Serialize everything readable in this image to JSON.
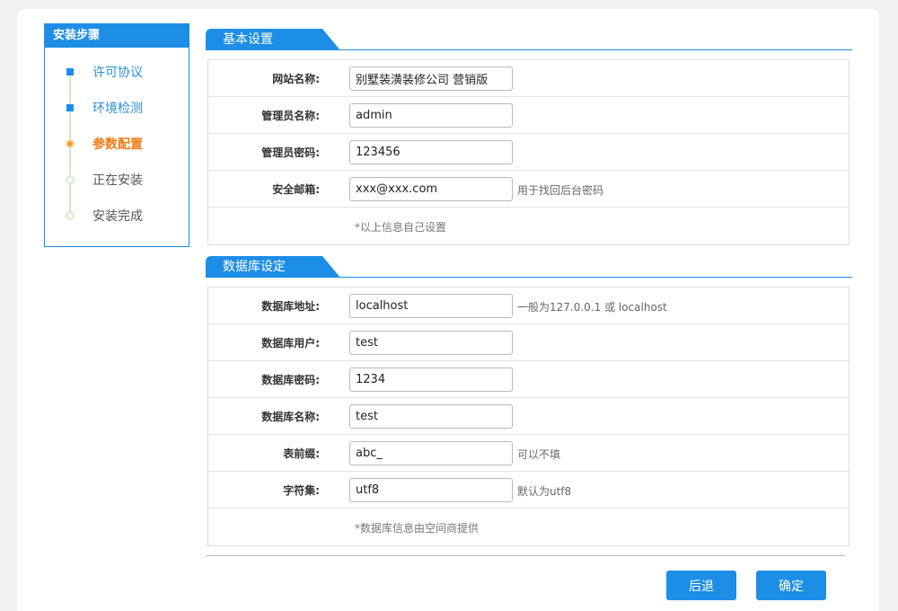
{
  "sidebar": {
    "title": "安装步骤",
    "steps": [
      {
        "label": "许可协议",
        "state": "done"
      },
      {
        "label": "环境检测",
        "state": "done"
      },
      {
        "label": "参数配置",
        "state": "current"
      },
      {
        "label": "正在安装",
        "state": "todo"
      },
      {
        "label": "安装完成",
        "state": "todo"
      }
    ]
  },
  "basic": {
    "title": "基本设置",
    "site_name_label": "网站名称:",
    "site_name_value": "别墅装潢装修公司 营销版",
    "admin_name_label": "管理员名称:",
    "admin_name_value": "admin",
    "admin_pwd_label": "管理员密码:",
    "admin_pwd_value": "123456",
    "email_label": "安全邮箱:",
    "email_value": "xxx@xxx.com",
    "email_hint": "用于找回后台密码",
    "note": "*以上信息自己设置"
  },
  "database": {
    "title": "数据库设定",
    "host_label": "数据库地址:",
    "host_value": "localhost",
    "host_hint": "一般为127.0.0.1 或 localhost",
    "user_label": "数据库用户:",
    "user_value": "test",
    "pwd_label": "数据库密码:",
    "pwd_value": "1234",
    "name_label": "数据库名称:",
    "name_value": "test",
    "prefix_label": "表前缀:",
    "prefix_value": "abc_",
    "prefix_hint": "可以不填",
    "charset_label": "字符集:",
    "charset_value": "utf8",
    "charset_hint": "默认为utf8",
    "note": "*数据库信息由空间商提供"
  },
  "actions": {
    "back_label": "后退",
    "confirm_label": "确定"
  },
  "colors": {
    "accent": "#1d8ee6",
    "current_step": "#f07a14"
  }
}
